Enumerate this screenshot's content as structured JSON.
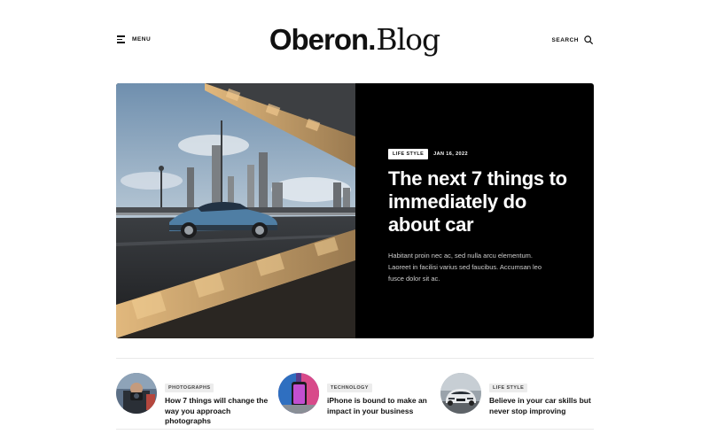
{
  "header": {
    "menu_label": "MENU",
    "logo_brand": "Oberon",
    "logo_dot": ".",
    "logo_suffix": "Blog",
    "search_label": "SEARCH"
  },
  "featured": {
    "category": "LIFE STYLE",
    "date": "JAN 16, 2022",
    "title": "The next 7 things to immediately do about car",
    "excerpt": "Habitant proin nec ac, sed nulla arcu elementum. Laoreet in facilisi varius sed faucibus. Accumsan leo fusce dolor sit ac.",
    "image_icon": "car-on-bridge-photo"
  },
  "posts": [
    {
      "category": "PHOTOGRAPHS",
      "title": "How 7 things will change the way you approach photographs",
      "image_icon": "photographer-photo"
    },
    {
      "category": "TECHNOLOGY",
      "title": "iPhone is bound to make an impact in your business",
      "image_icon": "iphone-photo"
    },
    {
      "category": "LIFE STYLE",
      "title": "Believe in your car skills but never stop improving",
      "image_icon": "car-photo"
    }
  ],
  "colors": {
    "hero_bg": "#000000",
    "text": "#111111",
    "tag_grey": "#ececec"
  }
}
